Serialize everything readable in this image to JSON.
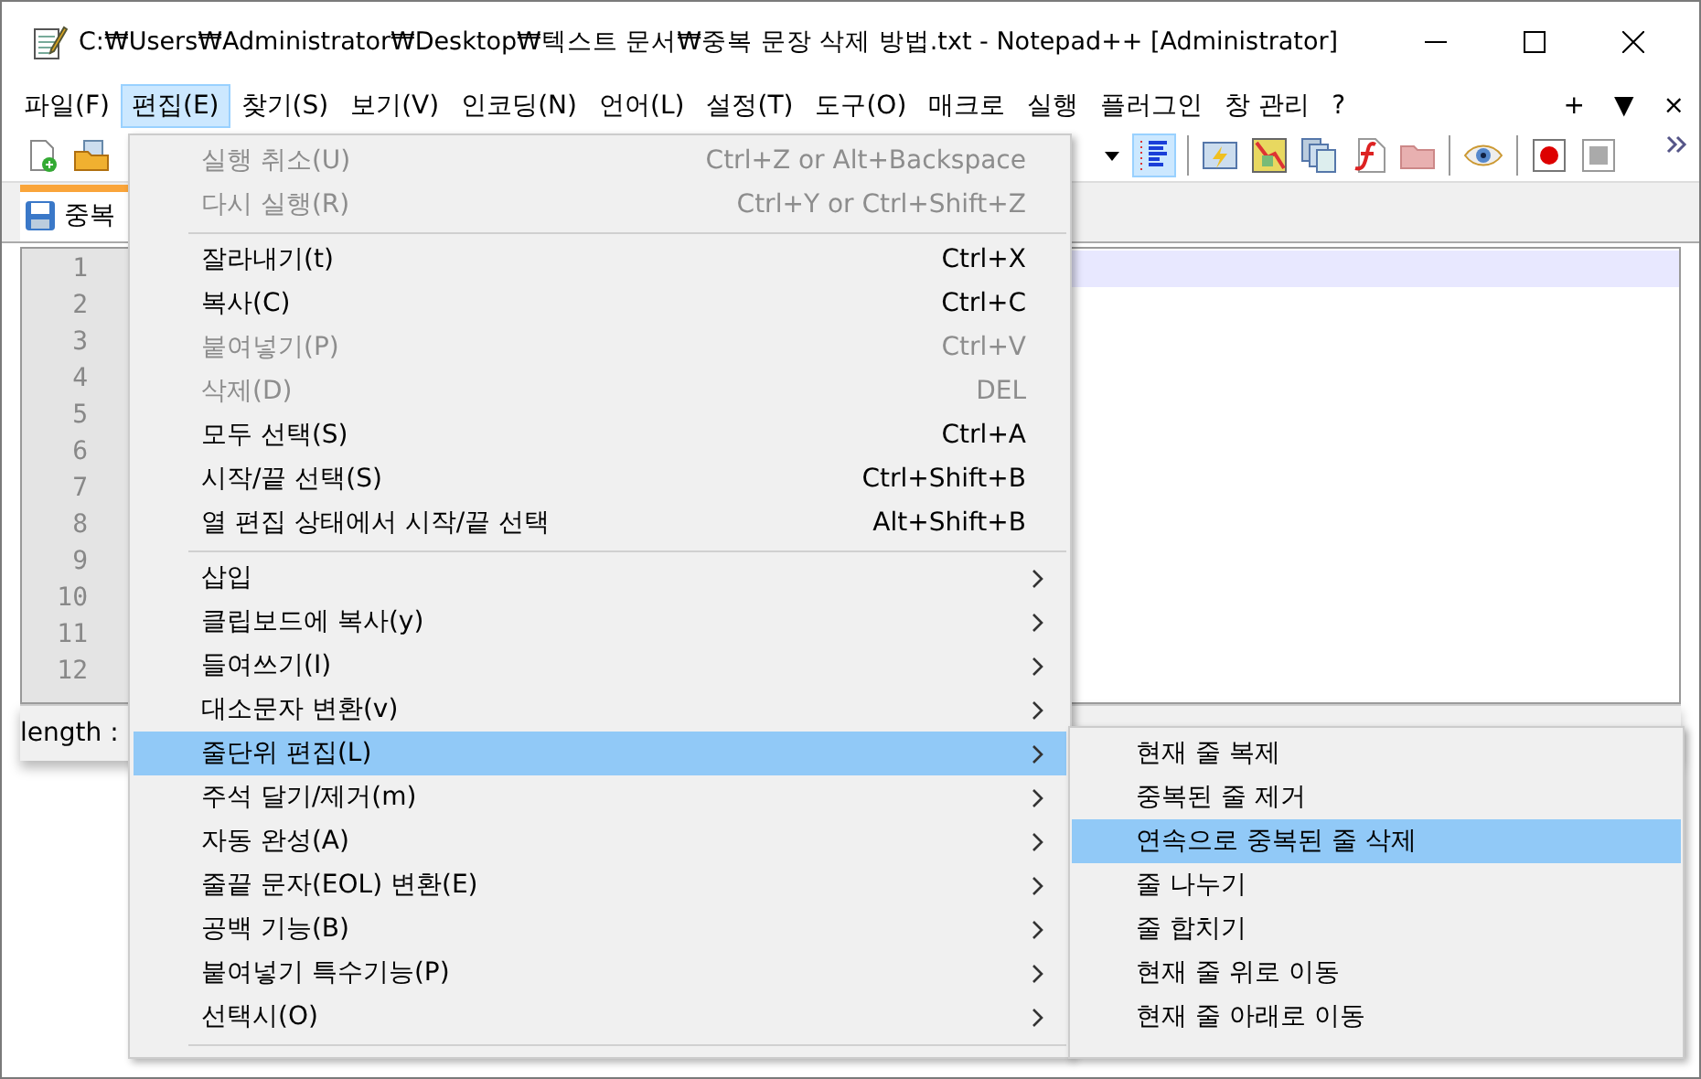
{
  "window": {
    "title": "C:₩Users₩Administrator₩Desktop₩텍스트 문서₩중복 문장 삭제 방법.txt - Notepad++ [Administrator]"
  },
  "menubar": {
    "items": [
      {
        "label": "파일(F)",
        "selected": false
      },
      {
        "label": "편집(E)",
        "selected": true
      },
      {
        "label": "찾기(S)",
        "selected": false
      },
      {
        "label": "보기(V)",
        "selected": false
      },
      {
        "label": "인코딩(N)",
        "selected": false
      },
      {
        "label": "언어(L)",
        "selected": false
      },
      {
        "label": "설정(T)",
        "selected": false
      },
      {
        "label": "도구(O)",
        "selected": false
      },
      {
        "label": "매크로",
        "selected": false
      },
      {
        "label": "실행",
        "selected": false
      },
      {
        "label": "플러그인",
        "selected": false
      },
      {
        "label": "창 관리",
        "selected": false
      },
      {
        "label": "?",
        "selected": false
      }
    ],
    "extras": [
      "+",
      "▼",
      "×"
    ]
  },
  "tab": {
    "label": "중복"
  },
  "editor": {
    "line_numbers": [
      "1",
      "2",
      "3",
      "4",
      "5",
      "6",
      "7",
      "8",
      "9",
      "10",
      "11",
      "12"
    ]
  },
  "status_bar": {
    "length": "length :"
  },
  "edit_menu": [
    {
      "kind": "item",
      "label": "실행 취소(U)",
      "shortcut": "Ctrl+Z or Alt+Backspace",
      "disabled": true,
      "selected": false
    },
    {
      "kind": "item",
      "label": "다시 실행(R)",
      "shortcut": "Ctrl+Y or Ctrl+Shift+Z",
      "disabled": true,
      "selected": false
    },
    {
      "kind": "separator"
    },
    {
      "kind": "item",
      "label": "잘라내기(t)",
      "shortcut": "Ctrl+X",
      "disabled": false,
      "selected": false
    },
    {
      "kind": "item",
      "label": "복사(C)",
      "shortcut": "Ctrl+C",
      "disabled": false,
      "selected": false
    },
    {
      "kind": "item",
      "label": "붙여넣기(P)",
      "shortcut": "Ctrl+V",
      "disabled": true,
      "selected": false
    },
    {
      "kind": "item",
      "label": "삭제(D)",
      "shortcut": "DEL",
      "disabled": true,
      "selected": false
    },
    {
      "kind": "item",
      "label": "모두 선택(S)",
      "shortcut": "Ctrl+A",
      "disabled": false,
      "selected": false
    },
    {
      "kind": "item",
      "label": "시작/끝 선택(S)",
      "shortcut": "Ctrl+Shift+B",
      "disabled": false,
      "selected": false
    },
    {
      "kind": "item",
      "label": "열 편집 상태에서 시작/끝 선택",
      "shortcut": "Alt+Shift+B",
      "disabled": false,
      "selected": false
    },
    {
      "kind": "separator"
    },
    {
      "kind": "submenu",
      "label": "삽입",
      "disabled": false,
      "selected": false
    },
    {
      "kind": "submenu",
      "label": "클립보드에 복사(y)",
      "disabled": false,
      "selected": false
    },
    {
      "kind": "submenu",
      "label": "들여쓰기(I)",
      "disabled": false,
      "selected": false
    },
    {
      "kind": "submenu",
      "label": "대소문자 변환(v)",
      "disabled": false,
      "selected": false
    },
    {
      "kind": "submenu",
      "label": "줄단위 편집(L)",
      "disabled": false,
      "selected": true
    },
    {
      "kind": "submenu",
      "label": "주석 달기/제거(m)",
      "disabled": false,
      "selected": false
    },
    {
      "kind": "submenu",
      "label": "자동 완성(A)",
      "disabled": false,
      "selected": false
    },
    {
      "kind": "submenu",
      "label": "줄끝 문자(EOL) 변환(E)",
      "disabled": false,
      "selected": false
    },
    {
      "kind": "submenu",
      "label": "공백 기능(B)",
      "disabled": false,
      "selected": false
    },
    {
      "kind": "submenu",
      "label": "붙여넣기 특수기능(P)",
      "disabled": false,
      "selected": false
    },
    {
      "kind": "submenu",
      "label": "선택시(O)",
      "disabled": false,
      "selected": false
    },
    {
      "kind": "separator"
    }
  ],
  "line_submenu": [
    {
      "label": "현재 줄 복제",
      "selected": false
    },
    {
      "label": "중복된 줄 제거",
      "selected": false
    },
    {
      "label": "연속으로 중복된 줄 삭제",
      "selected": true
    },
    {
      "label": "줄 나누기",
      "selected": false
    },
    {
      "label": "줄 합치기",
      "selected": false
    },
    {
      "label": "현재 줄 위로 이동",
      "selected": false
    },
    {
      "label": "현재 줄 아래로 이동",
      "selected": false
    }
  ]
}
